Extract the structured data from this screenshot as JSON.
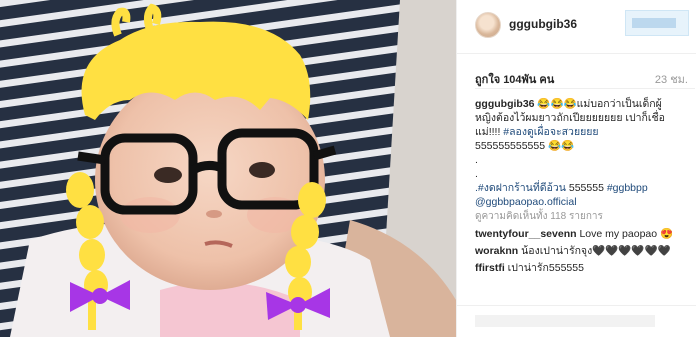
{
  "post": {
    "username": "gggubgib36",
    "likes": "ถูกใจ 104พัน คน",
    "time": "23 ชม.",
    "caption": {
      "user": "gggubgib36",
      "line1": "😂😂😂แม่บอกว่าเป็นเด็กผู้",
      "line2": "หญิงต้องไว้ผมยาวถักเปียยยยยยย เปาก็เชื่อ",
      "line3_text": "แม่!!!! ",
      "line3_tag": "#ลองดูเผื่อจะสวยยยย",
      "line4": "555555555555 😂😂",
      "dot1": ".",
      "dot2": ".",
      "line7_tag": ".#งดฝากร้านที่ดีอ้วน",
      "line7_text": " 555555 ",
      "line7_tag2": "#ggbbpp",
      "line8_tag": "@ggbbpaopao.official"
    },
    "view_all": "ดูความคิดเห็นทั้ง 118 รายการ",
    "comments": [
      {
        "user": "twentyfour__sevenn",
        "text": " Love my paopao 😍"
      },
      {
        "user": "woraknn",
        "text": " น้องเปาน่ารักจุง🖤🖤🖤🖤🖤🖤"
      },
      {
        "user": "ffirstfi",
        "text": " เปาน่ารัก555555"
      }
    ]
  }
}
